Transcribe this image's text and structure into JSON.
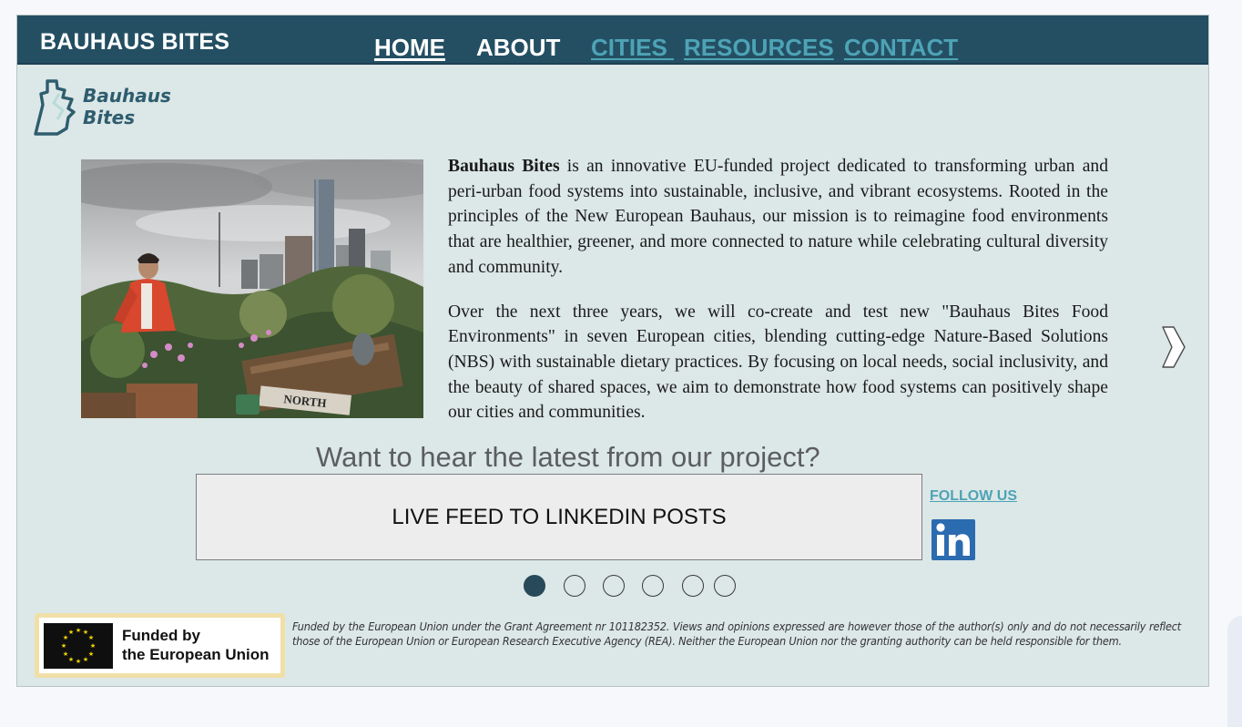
{
  "header": {
    "brand": "BAUHAUS BITES",
    "nav": {
      "home": "HOME",
      "about": "ABOUT",
      "cities": "CITIES ",
      "resources": "RESOURCES",
      "contact": "CONTACT"
    }
  },
  "logo": {
    "line1": "Bauhaus",
    "line2": "Bites"
  },
  "intro": {
    "p1_bold": "Bauhaus Bites",
    "p1_rest": " is an innovative EU-funded project dedicated to transforming urban and peri-urban food systems into sustainable, inclusive, and vibrant ecosystems. Rooted in the principles of the New European Bauhaus, our mission is to reimagine food environments that are healthier, greener, and more connected to nature while celebrating cultural diversity and community.",
    "p2": "Over the next three years, we will co-create and test new \"Bauhaus Bites Food Environments\" in seven European cities, blending cutting-edge Nature-Based Solutions (NBS) with sustainable dietary practices. By focusing on local needs, social inclusivity, and the beauty of shared spaces, we aim to demonstrate how food systems can positively shape our cities and communities.",
    "photo_sign": "NORTH"
  },
  "newsletter": {
    "title": "Want to hear the latest from our project?",
    "feed_label": "LIVE FEED TO LINKEDIN POSTS",
    "follow_label": "FOLLOW US",
    "linkedin_icon": "linkedin-icon"
  },
  "carousel": {
    "total_slides": 6,
    "active_index": 0
  },
  "footer": {
    "eu_line1": "Funded by",
    "eu_line2": "the European Union",
    "disclaimer": "Funded by the European Union under the Grant Agreement nr 101182352. Views and opinions expressed are however those of the author(s) only and do not necessarily reflect those of the European Union or European Research Executive Agency (REA). Neither the European Union nor the granting authority can be held responsible for them."
  },
  "colors": {
    "header_bg": "#244f63",
    "page_bg": "#dce7e7",
    "link_teal": "#4ea3b6",
    "dot_active": "#28495a",
    "linkedin_blue": "#2b6bb0",
    "eu_badge": "#f0e0a8"
  }
}
